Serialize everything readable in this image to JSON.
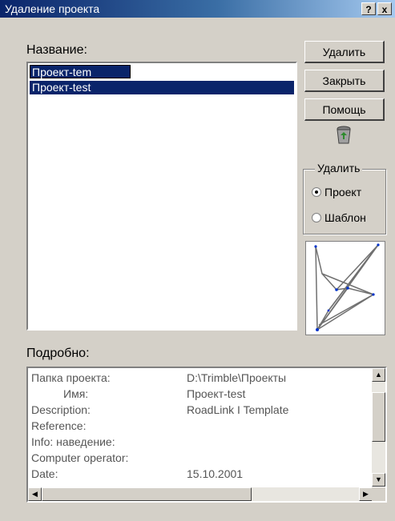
{
  "window": {
    "title": "Удаление проекта",
    "help_label": "?",
    "close_label": "x"
  },
  "projects": {
    "label": "Название:",
    "edit_value": "Проект-tem",
    "selected_item": "Проект-test"
  },
  "buttons": {
    "delete": "Удалить",
    "close": "Закрыть",
    "help": "Помощь"
  },
  "sort": {
    "legend": "Удалить",
    "option1": "Проект",
    "option2": "Шаблон",
    "selected": "option1"
  },
  "details": {
    "label": "Подробно:",
    "rows": [
      {
        "key": "Папка проекта:",
        "value": "D:\\Trimble\\Проекты"
      },
      {
        "key": "Имя:",
        "value": "Проект-test"
      },
      {
        "key": "Description:",
        "value": "RoadLink I Template"
      },
      {
        "key": "Reference:",
        "value": ""
      },
      {
        "key": "Info: наведение:",
        "value": ""
      },
      {
        "key": "Computer operator:",
        "value": ""
      },
      {
        "key": "Date:",
        "value": "15.10.2001"
      }
    ]
  },
  "icons": {
    "recycle": "recycle-bin-icon",
    "scroll_up": "arrow-up-icon",
    "scroll_down": "arrow-down-icon",
    "scroll_left": "arrow-left-icon",
    "scroll_right": "arrow-right-icon"
  }
}
